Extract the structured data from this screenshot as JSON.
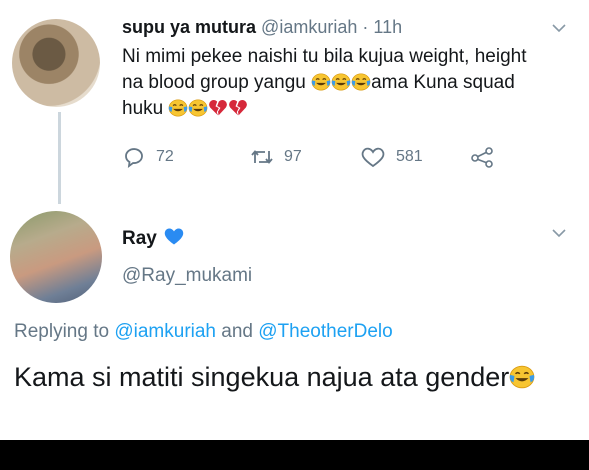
{
  "tweet": {
    "author_name": "supu ya mutura",
    "author_handle": "@iamkuriah",
    "separator": "·",
    "time": "11h",
    "text_line1": "Ni mimi pekee naishi tu bila kujua weight, height",
    "text_line2_pre": "na blood group yangu ",
    "text_line2_post": "ama Kuna squad",
    "text_line3": "huku ",
    "reply_count": "72",
    "retweet_count": "97",
    "like_count": "581"
  },
  "reply": {
    "author_name": "Ray",
    "author_handle": "@Ray_mukami",
    "replying_prefix": "Replying to ",
    "mention1": "@iamkuriah",
    "and_word": " and ",
    "mention2": "@TheotherDelo",
    "text": "Kama si matiti singekua najua ata gender"
  },
  "icons": {
    "emoji_laugh": "face-with-tears-of-joy-icon",
    "emoji_broken_heart": "broken-heart-icon",
    "verified_badge": "blue-heart-icon"
  },
  "colors": {
    "link": "#1da1f2",
    "secondary_text": "#657786",
    "primary_text": "#14171a"
  }
}
